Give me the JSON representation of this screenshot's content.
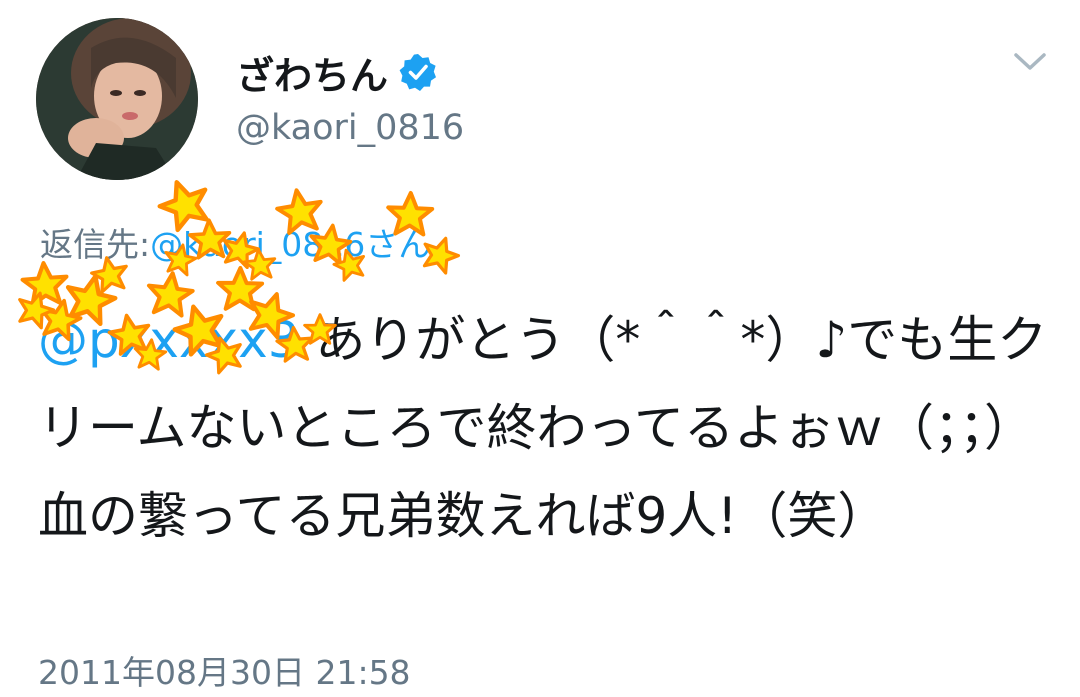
{
  "header": {
    "display_name": "ざわちん",
    "username": "@kaori_0816",
    "verified": true
  },
  "reply": {
    "prefix": "返信先:",
    "handle": "@kaori_0816さん"
  },
  "tweet": {
    "mention": "@pxxxxx3",
    "body": " ありがとう（*＾＾*）♪でも生クリームないところで終わってるよぉｗ（；；）血の繋ってる兄弟数えれば9人!（笑）",
    "timestamp": "2011年08月30日 21:58"
  },
  "icons": {
    "verified": "verified-badge-icon",
    "menu": "chevron-down-icon"
  },
  "colors": {
    "accent": "#1da1f2",
    "secondary_text": "#657786",
    "primary_text": "#14171a",
    "sticker_fill": "#ffe100",
    "sticker_outline": "#ff8c00"
  }
}
